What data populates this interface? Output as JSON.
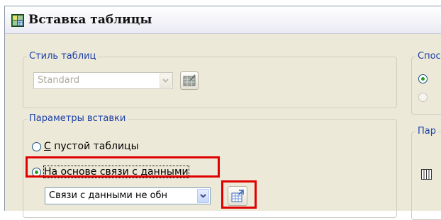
{
  "window": {
    "title": "Вставка таблицы"
  },
  "table_style_group": {
    "legend": "Стиль таблиц",
    "combo_value": "Standard",
    "combo_disabled": true
  },
  "insert_params_group": {
    "legend": "Параметры вставки",
    "option_empty_mnemonic": "С",
    "option_empty_rest": " пустой таблицы",
    "option_link": "На основе связи с данными",
    "link_combo_value": "Связи с данными не обн",
    "selected_option": "На основе связи с данными"
  },
  "right_groups": {
    "insert_method_legend": "Спос",
    "params_legend": "Пар"
  },
  "colors": {
    "highlight": "#e00000",
    "legend_text": "#1c3fa8",
    "dialog_bg": "#ece9d8"
  },
  "icons": [
    "table-insert-app-icon",
    "table-style-dialog-icon",
    "data-link-manager-icon",
    "chevron-down-icon",
    "columns-icon"
  ]
}
